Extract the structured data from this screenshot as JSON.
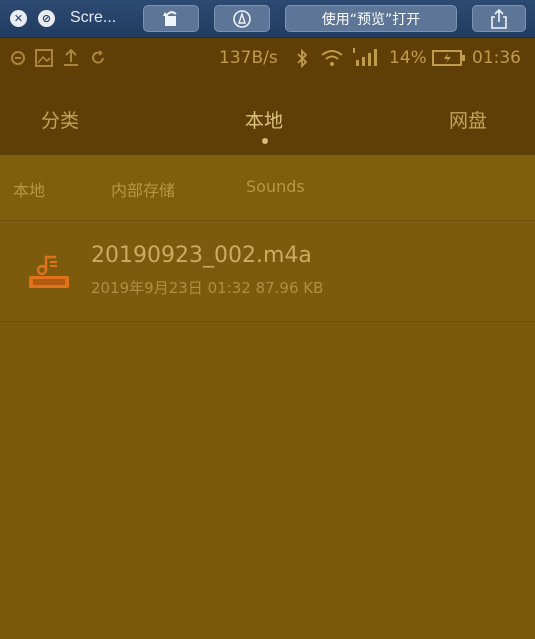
{
  "quicklook": {
    "title": "Scre...",
    "open_with_label": "使用“预览”打开",
    "icons": {
      "close": "close-icon",
      "block": "disable-icon",
      "rotate": "rotate-icon",
      "markup": "markup-icon",
      "share": "share-icon"
    }
  },
  "statusbar": {
    "speed": "137B/s",
    "battery_percent": "14%",
    "time": "01:36"
  },
  "tabs": [
    {
      "label": "分类"
    },
    {
      "label": "本地"
    },
    {
      "label": "网盘"
    }
  ],
  "breadcrumb": [
    {
      "label": "本地"
    },
    {
      "label": "内部存储"
    },
    {
      "label": "Sounds"
    }
  ],
  "files": [
    {
      "name": "20190923_002.m4a",
      "meta": "2019年9月23日 01:32 87.96 KB",
      "icon": "audio-file-icon"
    }
  ],
  "colors": {
    "header_bg": "#5f3f06",
    "screen_bg": "#7a5a0a",
    "accent": "#e0731a"
  }
}
